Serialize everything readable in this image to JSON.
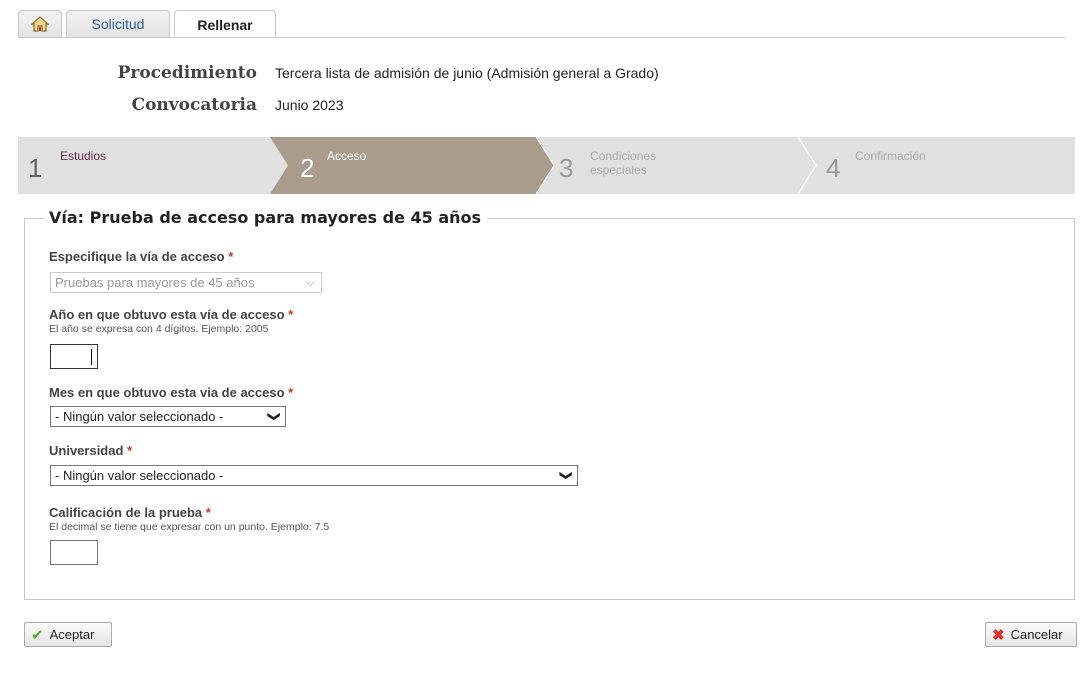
{
  "tabs": {
    "home_icon": "home-icon",
    "solicitud": "Solicitud",
    "rellenar": "Rellenar"
  },
  "info": {
    "procedimiento_label": "Procedimiento",
    "procedimiento_value": "Tercera lista de admisión de junio (Admisión general a Grado)",
    "convocatoria_label": "Convocatoria",
    "convocatoria_value": "Junio 2023"
  },
  "wizard": {
    "steps": [
      {
        "num": "1",
        "label": "Estudios"
      },
      {
        "num": "2",
        "label": "Acceso"
      },
      {
        "num": "3",
        "label": "Condiciones especiales"
      },
      {
        "num": "4",
        "label": "Confirmación"
      }
    ],
    "active_step": 2,
    "colors": {
      "active": "#a99c8c",
      "inactive": "#e0e0e0"
    }
  },
  "form": {
    "legend": "Vía: Prueba de acceso para mayores de 45 años",
    "via_label": "Especifique la vía de acceso",
    "via_value": "Pruebas para mayores de 45 años",
    "anio_label": "Año en que obtuvo esta vía de acceso",
    "anio_hint": "El año se expresa con 4 dígitos. Ejemplo: 2005",
    "mes_label": "Mes en que obtuvo esta via de acceso",
    "mes_value": "- Ningún valor seleccionado -",
    "univ_label": "Universidad",
    "univ_value": "- Ningún valor seleccionado -",
    "calif_label": "Calificación de la prueba",
    "calif_hint": "El decimal se tiene que expresar con un punto. Ejemplo: 7.5",
    "required_mark": "*"
  },
  "buttons": {
    "accept": "Aceptar",
    "cancel": "Cancelar"
  }
}
